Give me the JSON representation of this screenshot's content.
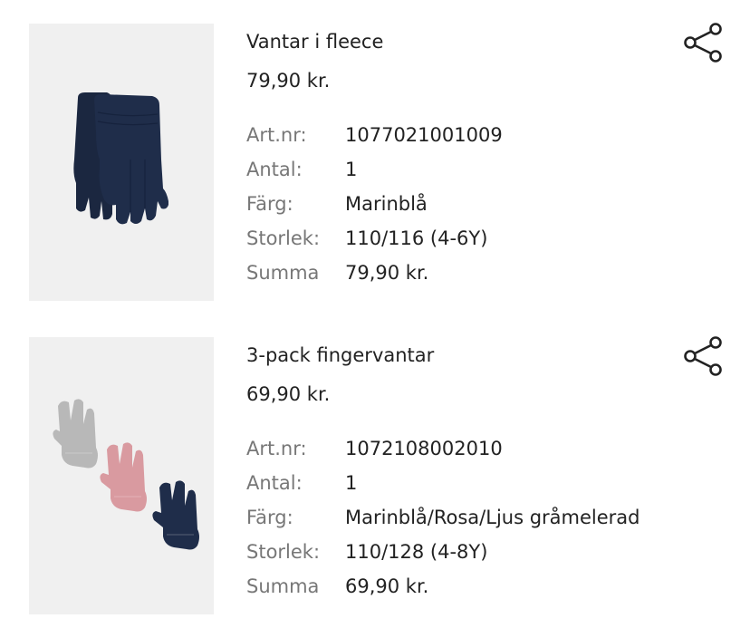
{
  "items": [
    {
      "title": "Vantar i fleece",
      "price": "79,90 kr.",
      "details": [
        {
          "label": "Art.nr:",
          "value": "1077021001009"
        },
        {
          "label": "Antal:",
          "value": "1"
        },
        {
          "label": "Färg:",
          "value": "Marinblå"
        },
        {
          "label": "Storlek:",
          "value": "110/116 (4-6Y)"
        },
        {
          "label": "Summa",
          "value": "79,90 kr."
        }
      ],
      "image": {
        "subject": "navy-fleece-gloves",
        "colors": [
          "#1c2a44"
        ]
      }
    },
    {
      "title": "3-pack fingervantar",
      "price": "69,90 kr.",
      "details": [
        {
          "label": "Art.nr:",
          "value": "1072108002010"
        },
        {
          "label": "Antal:",
          "value": "1"
        },
        {
          "label": "Färg:",
          "value": "Marinblå/Rosa/Ljus gråmelerad"
        },
        {
          "label": "Storlek:",
          "value": "110/128 (4-8Y)"
        },
        {
          "label": "Summa",
          "value": "69,90 kr."
        }
      ],
      "image": {
        "subject": "three-knit-gloves",
        "colors": [
          "#b8b8b8",
          "#d99aa0",
          "#1f2d4a"
        ]
      }
    }
  ],
  "icons": {
    "share": "share-icon"
  },
  "colors": {
    "text": "#222222",
    "label": "#777777",
    "image_bg": "#f0f0f0"
  }
}
